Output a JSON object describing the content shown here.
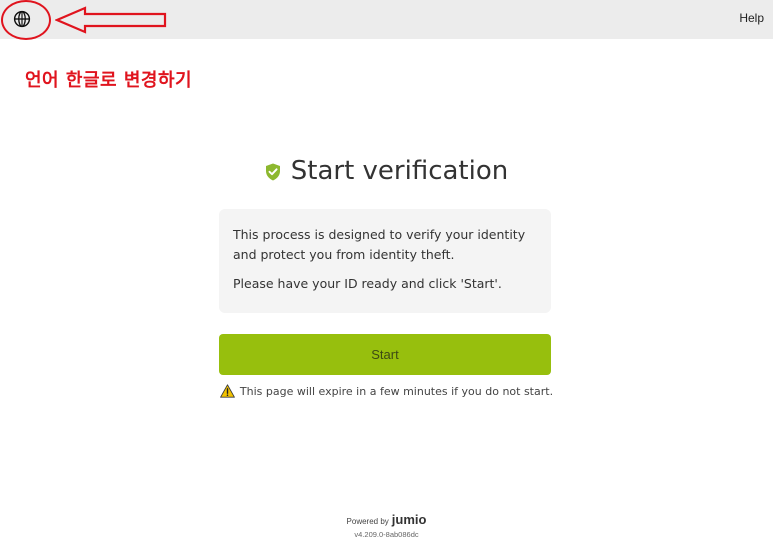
{
  "header": {
    "language_icon": "globe-icon",
    "help_label": "Help"
  },
  "annotation": {
    "text": "언어 한글로 변경하기",
    "color": "#e0141e"
  },
  "main": {
    "title_icon": "shield-check-icon",
    "title": "Start verification",
    "info_paragraph_1": "This process is designed to verify your identity and protect you from identity theft.",
    "info_paragraph_2": "Please have your ID ready and click 'Start'.",
    "start_label": "Start",
    "warning_icon": "warning-triangle-icon",
    "expire_text": "This page will expire in a few minutes if you do not start."
  },
  "footer": {
    "powered_by": "Powered by",
    "brand": "jumio",
    "version": "v4.209.0-8ab086dc"
  },
  "colors": {
    "accent": "#97bf0d",
    "shield": "#8db82f",
    "warning": "#f2c200",
    "topbar": "#ececec"
  }
}
